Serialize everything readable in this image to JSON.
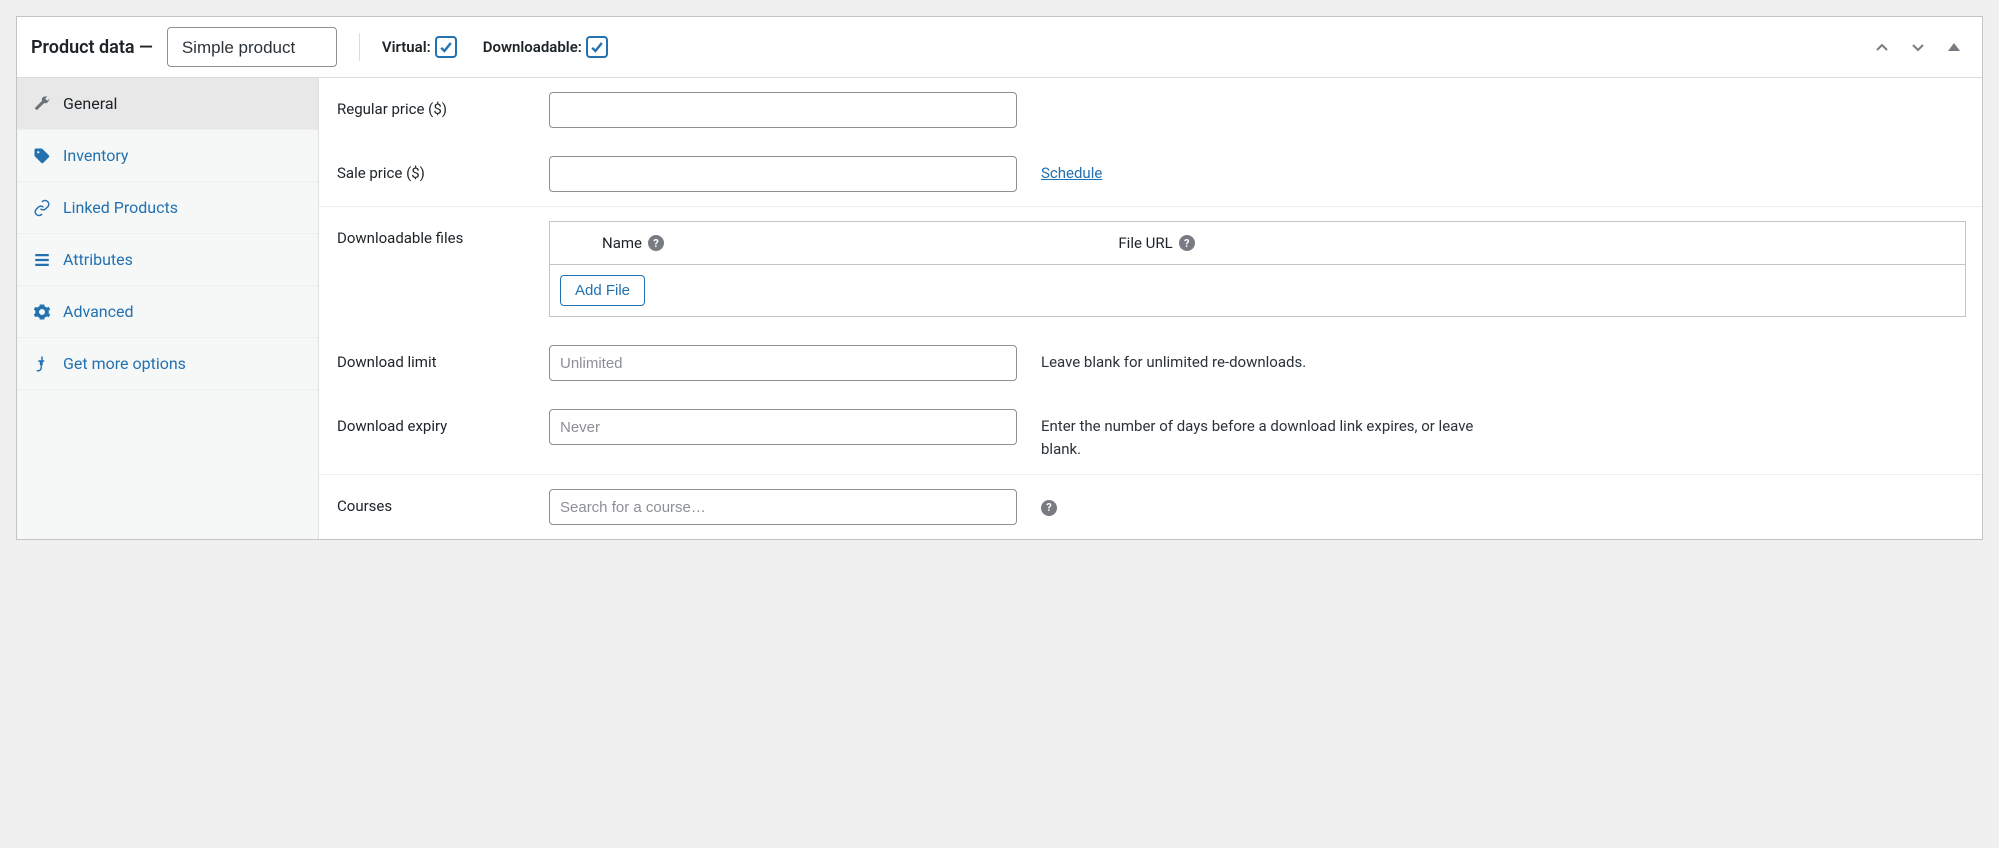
{
  "header": {
    "title": "Product data —",
    "product_type": "Simple product",
    "virtual_label": "Virtual:",
    "downloadable_label": "Downloadable:"
  },
  "tabs": {
    "general": "General",
    "inventory": "Inventory",
    "linked": "Linked Products",
    "attributes": "Attributes",
    "advanced": "Advanced",
    "get_more": "Get more options"
  },
  "fields": {
    "regular_price": {
      "label": "Regular price ($)",
      "value": ""
    },
    "sale_price": {
      "label": "Sale price ($)",
      "value": "",
      "schedule": "Schedule"
    },
    "downloadable_files": {
      "label": "Downloadable files",
      "col_name": "Name",
      "col_url": "File URL",
      "add_file": "Add File"
    },
    "download_limit": {
      "label": "Download limit",
      "placeholder": "Unlimited",
      "help": "Leave blank for unlimited re-downloads."
    },
    "download_expiry": {
      "label": "Download expiry",
      "placeholder": "Never",
      "help": "Enter the number of days before a download link expires, or leave blank."
    },
    "courses": {
      "label": "Courses",
      "placeholder": "Search for a course…"
    }
  }
}
